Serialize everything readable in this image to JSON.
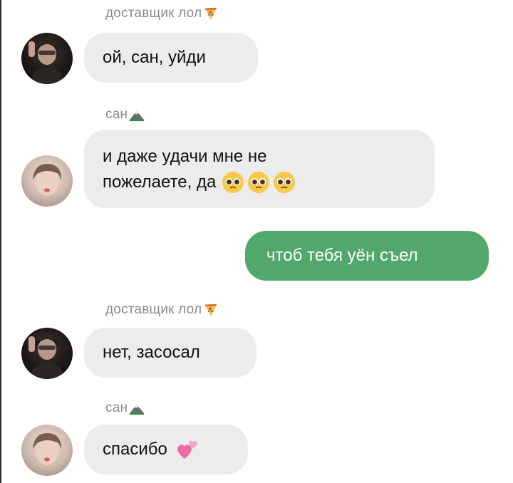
{
  "messages": [
    {
      "type": "sender",
      "name": "доставщик лол",
      "icon": "pizza-icon"
    },
    {
      "type": "in",
      "text": "ой, сан, уйди"
    },
    {
      "type": "sender",
      "name": "сан",
      "icon": "mountain-icon"
    },
    {
      "type": "in",
      "line1": "и даже удачи мне не",
      "line2": "пожелаете, да",
      "emojis": [
        "pleading-face-icon",
        "pleading-face-icon",
        "pleading-face-icon"
      ]
    },
    {
      "type": "out",
      "text": "чтоб тебя уён съел"
    },
    {
      "type": "sender",
      "name": "доставщик лол",
      "icon": "pizza-icon"
    },
    {
      "type": "in",
      "text": "нет, засосал"
    },
    {
      "type": "sender",
      "name": "сан",
      "icon": "mountain-icon"
    },
    {
      "type": "in",
      "text": "спасибо",
      "emoji": "two-hearts-icon"
    }
  ],
  "colors": {
    "incoming_bubble": "#ececec",
    "outgoing_bubble": "#52a86a",
    "sender_name": "#8a8a8a"
  }
}
